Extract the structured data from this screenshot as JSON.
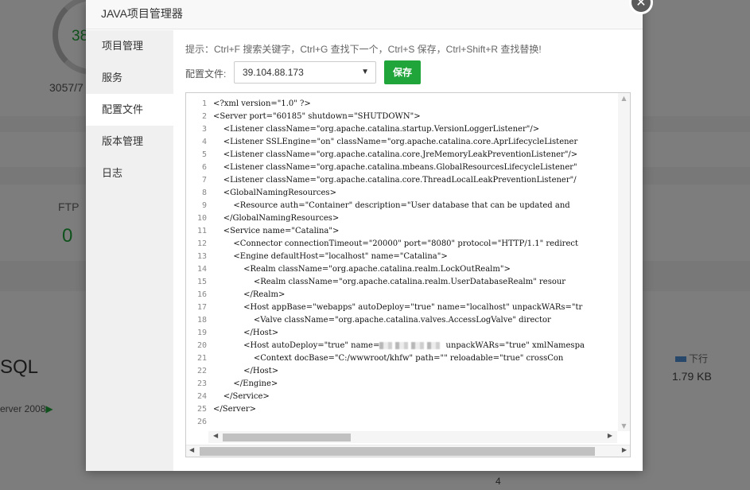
{
  "background": {
    "gauge_value": "38",
    "memory_text": "3057/7",
    "ftp_label": "FTP",
    "ftp_value": "0",
    "sql_label": "SQL",
    "sql_version": "erver 2008",
    "download_legend": "下行",
    "download_value": "1.79 KB",
    "axis_tick": "4"
  },
  "modal": {
    "title": "JAVA项目管理器",
    "close_glyph": "✕",
    "sidebar": {
      "items": [
        {
          "label": "项目管理"
        },
        {
          "label": "服务"
        },
        {
          "label": "配置文件"
        },
        {
          "label": "版本管理"
        },
        {
          "label": "日志"
        }
      ],
      "active_index": 2
    },
    "tip": "提示：Ctrl+F 搜索关键字，Ctrl+G 查找下一个，Ctrl+S 保存，Ctrl+Shift+R 查找替换!",
    "config_label": "配置文件:",
    "config_selected": "39.104.88.173",
    "save_label": "保存",
    "colors": {
      "accent": "#20a53a",
      "overlay": "rgba(0,0,0,0.5)"
    },
    "editor": {
      "lines": [
        "<?xml version=\"1.0\" ?>",
        "<Server port=\"60185\" shutdown=\"SHUTDOWN\">",
        "    <Listener className=\"org.apache.catalina.startup.VersionLoggerListener\"/>",
        "    <Listener SSLEngine=\"on\" className=\"org.apache.catalina.core.AprLifecycleListener",
        "    <Listener className=\"org.apache.catalina.core.JreMemoryLeakPreventionListener\"/>",
        "    <Listener className=\"org.apache.catalina.mbeans.GlobalResourcesLifecycleListener\"",
        "    <Listener className=\"org.apache.catalina.core.ThreadLocalLeakPreventionListener\"/",
        "    <GlobalNamingResources>",
        "        <Resource auth=\"Container\" description=\"User database that can be updated and",
        "    </GlobalNamingResources>",
        "    <Service name=\"Catalina\">",
        "        <Connector connectionTimeout=\"20000\" port=\"8080\" protocol=\"HTTP/1.1\" redirect",
        "        <Engine defaultHost=\"localhost\" name=\"Catalina\">",
        "            <Realm className=\"org.apache.catalina.realm.LockOutRealm\">",
        "                <Realm className=\"org.apache.catalina.realm.UserDatabaseRealm\" resour",
        "            </Realm>",
        "            <Host appBase=\"webapps\" autoDeploy=\"true\" name=\"localhost\" unpackWARs=\"tr",
        "                <Valve className=\"org.apache.catalina.valves.AccessLogValve\" director",
        "            </Host>",
        "            <Host autoDeploy=\"true\" name=",
        "                <Context docBase=\"C:/wwwroot/khfw\" path=\"\" reloadable=\"true\" crossCon",
        "            </Host>",
        "        </Engine>",
        "    </Service>",
        "</Server>",
        ""
      ],
      "line20_tail": " unpackWARs=\"true\" xmlNamespa"
    }
  }
}
